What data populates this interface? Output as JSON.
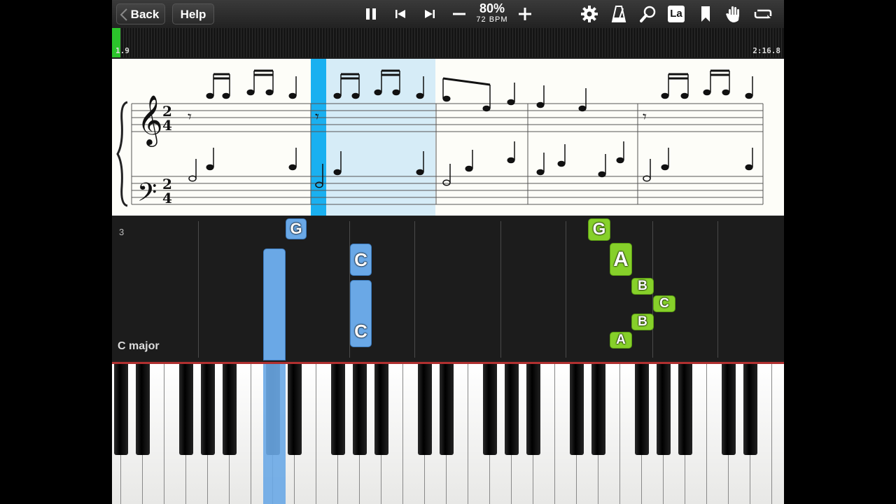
{
  "toolbar": {
    "back_label": "Back",
    "help_label": "Help",
    "speed_percent": "80%",
    "bpm": "72 BPM",
    "notation_label": "La"
  },
  "timeline": {
    "position_label": "1.9",
    "total_time": "2:16.8",
    "progress": 0.013
  },
  "roll": {
    "measure_number": "3",
    "key_name": "C major",
    "notes": [
      "G",
      "C",
      "C",
      "G",
      "A",
      "B",
      "C",
      "B",
      "A"
    ]
  },
  "colors": {
    "right_hand": "#86d02a",
    "left_hand": "#6aa8e6",
    "playhead": "#1ab0f0",
    "progress": "#2bc52b"
  }
}
